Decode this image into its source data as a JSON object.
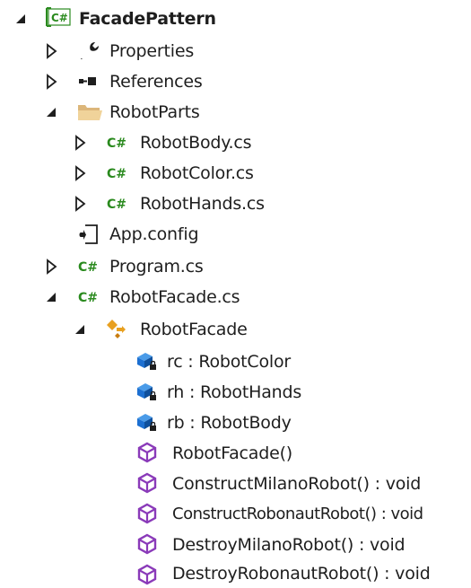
{
  "tree": {
    "rows": [
      {
        "label": "FacadePattern",
        "icon": "csharp-project-icon",
        "expander": "expanded"
      },
      {
        "label": "Properties",
        "icon": "wrench-icon",
        "expander": "collapsed"
      },
      {
        "label": "References",
        "icon": "references-icon",
        "expander": "collapsed"
      },
      {
        "label": "RobotParts",
        "icon": "folder-open-icon",
        "expander": "expanded"
      },
      {
        "label": "RobotBody.cs",
        "icon": "csharp-file-icon",
        "expander": "collapsed"
      },
      {
        "label": "RobotColor.cs",
        "icon": "csharp-file-icon",
        "expander": "collapsed"
      },
      {
        "label": "RobotHands.cs",
        "icon": "csharp-file-icon",
        "expander": "collapsed"
      },
      {
        "label": "App.config",
        "icon": "config-file-icon",
        "expander": "none"
      },
      {
        "label": "Program.cs",
        "icon": "csharp-file-icon",
        "expander": "collapsed"
      },
      {
        "label": "RobotFacade.cs",
        "icon": "csharp-file-icon",
        "expander": "expanded"
      },
      {
        "label": "RobotFacade",
        "icon": "class-icon",
        "expander": "expanded"
      },
      {
        "label": "rc : RobotColor",
        "icon": "private-field-icon",
        "expander": "none"
      },
      {
        "label": "rh : RobotHands",
        "icon": "private-field-icon",
        "expander": "none"
      },
      {
        "label": "rb : RobotBody",
        "icon": "private-field-icon",
        "expander": "none"
      },
      {
        "label": "RobotFacade()",
        "icon": "method-icon",
        "expander": "none"
      },
      {
        "label": "ConstructMilanoRobot() : void",
        "icon": "method-icon",
        "expander": "none"
      },
      {
        "label": "ConstructRobonautRobot() : void",
        "icon": "method-icon",
        "expander": "none"
      },
      {
        "label": "DestroyMilanoRobot() : void",
        "icon": "method-icon",
        "expander": "none"
      },
      {
        "label": "DestroyRobonautRobot() : void",
        "icon": "method-icon",
        "expander": "none"
      }
    ],
    "colors": {
      "csharp_green": "#2a8a1e",
      "folder": "#dcb67a",
      "class_orange": "#e8a020",
      "field_blue": "#1c6fd1",
      "method_purple": "#8a3ab9"
    }
  }
}
